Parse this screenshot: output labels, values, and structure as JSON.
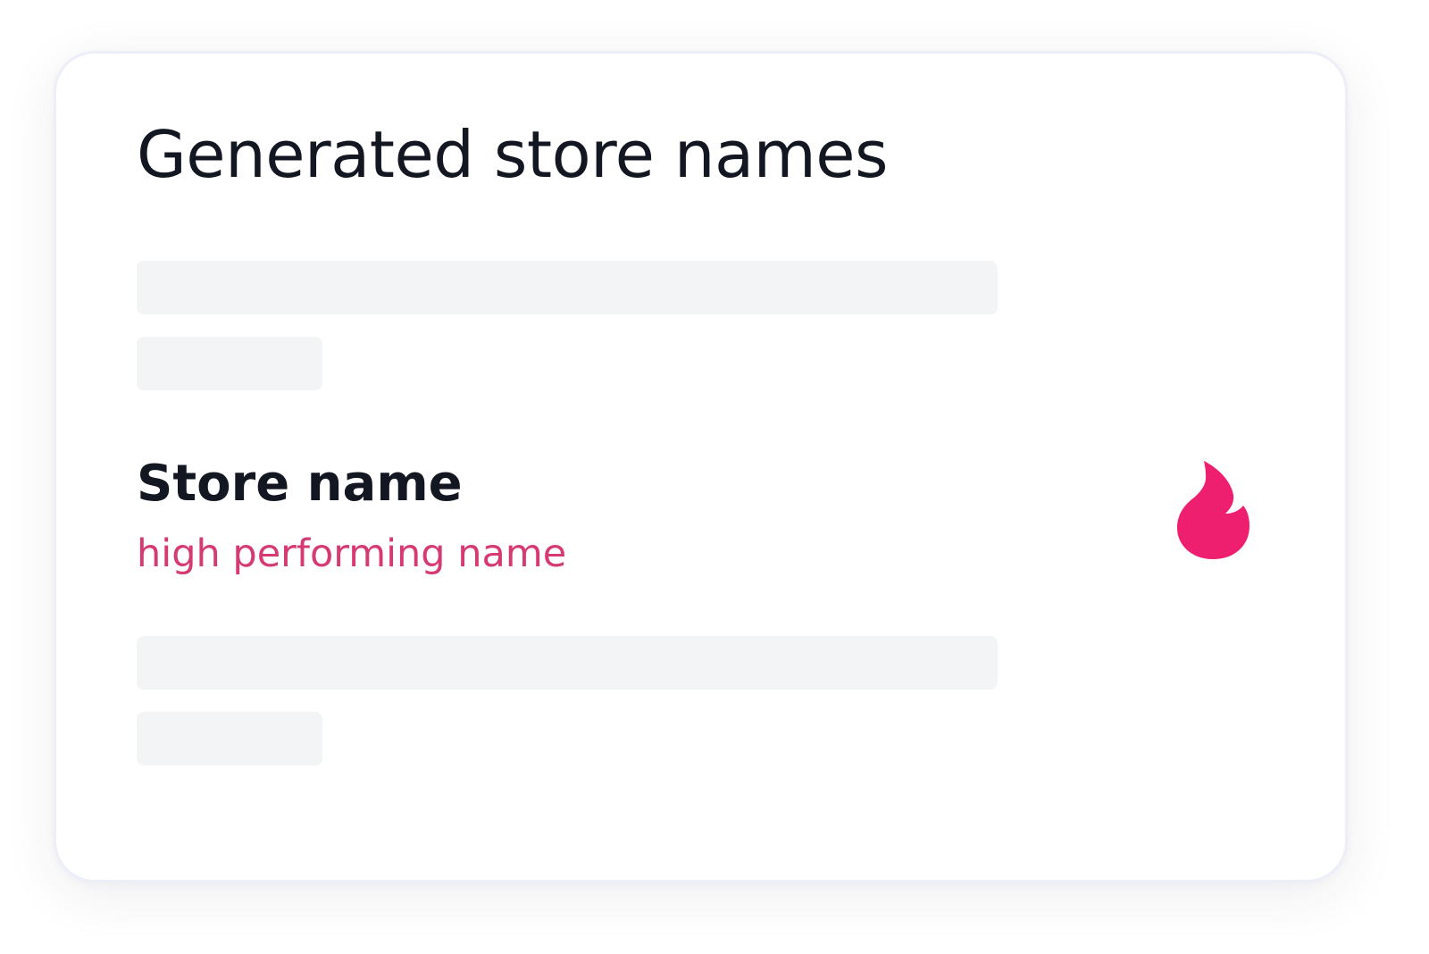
{
  "card": {
    "title": "Generated store names"
  },
  "result": {
    "name": "Store name",
    "tag": "high performing name",
    "icon": "flame-icon"
  },
  "colors": {
    "accent": "#ee1f6f",
    "tag_text": "#d63a73",
    "heading": "#131722",
    "skeleton": "#f3f4f6"
  }
}
